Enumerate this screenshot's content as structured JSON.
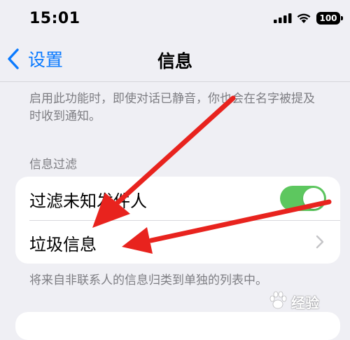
{
  "status_bar": {
    "time": "15:01",
    "battery": "100",
    "icons": [
      "cellular-signal-icon",
      "wifi-icon",
      "battery-icon"
    ]
  },
  "nav": {
    "back_label": "设置",
    "title": "信息"
  },
  "description_top": "启用此功能时，即使对话已静音，你也会在名字被提及时收到通知。",
  "filter_section": {
    "header": "信息过滤",
    "rows": [
      {
        "label": "过滤未知发件人",
        "control": "toggle",
        "toggle_on": true
      },
      {
        "label": "垃圾信息",
        "control": "chevron"
      }
    ],
    "footer": "将来自非联系人的信息归类到单独的列表中。"
  },
  "colors": {
    "accent": "#0a7aff",
    "toggle_on": "#5dc75f",
    "annotation_arrow": "#e8231e",
    "background": "#efeff4",
    "secondary_text": "#7d7d82"
  },
  "watermark": {
    "logo_name": "baidu-paw-icon",
    "text": "经验"
  }
}
